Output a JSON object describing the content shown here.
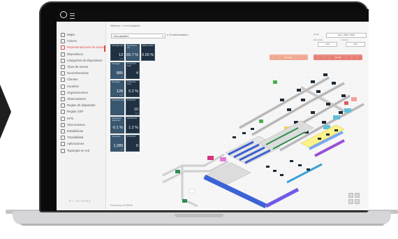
{
  "breadcrumb": "Waterrup  >  Línea playables",
  "sidebar": {
    "items": [
      {
        "label": "Mapa",
        "active": false
      },
      {
        "label": "Activos",
        "active": false
      },
      {
        "label": "Representaciones de activos",
        "active": true
      },
      {
        "label": "Dispositivos",
        "active": false
      },
      {
        "label": "Categorías de dispositivos",
        "active": false
      },
      {
        "label": "Tipos de sensor",
        "active": false
      },
      {
        "label": "Georreferencias",
        "active": false
      },
      {
        "label": "Clientes",
        "active": false
      },
      {
        "label": "Usuarios",
        "active": false
      },
      {
        "label": "Organizaciones",
        "active": false
      },
      {
        "label": "Observadores",
        "active": false
      },
      {
        "label": "Reglas de disparador",
        "active": false
      },
      {
        "label": "Reglas CEP",
        "active": false
      },
      {
        "label": "KPIs",
        "active": false
      },
      {
        "label": "Sincronismos",
        "active": false
      },
      {
        "label": "Estadísticas",
        "active": false
      },
      {
        "label": "Trazabilidad",
        "active": false
      },
      {
        "label": "Aplicaciones",
        "active": false
      },
      {
        "label": "Topología en red",
        "active": false
      }
    ],
    "brand": "BY IOTSENS"
  },
  "filter": {
    "value": "Línea playables",
    "selected_label": "10 seleccionados"
  },
  "date_panel": {
    "label_from": "Desde",
    "date_value": "Apr 1, 2020 - Tarde",
    "label_start": "Hora inicio",
    "label_end": "Hora fin",
    "start_value": "1:00",
    "end_value": "1:52"
  },
  "actions": {
    "left_button": "Exportar",
    "right_button": "Cerrar"
  },
  "metric_cards": [
    {
      "title": "Total agua (l/h)",
      "value": "13",
      "unit": "m³/h"
    },
    {
      "title": "Rendimiento (%)",
      "value": "65.7 %",
      "unit": ""
    },
    {
      "title": "Ratio de fallos",
      "value": "0.00 %",
      "unit": ""
    },
    {
      "title": "Total agua",
      "value": "885",
      "unit": "m³"
    },
    {
      "title": "Producción bruta",
      "value": "4",
      "unit": ""
    },
    {
      "title": "Total agua",
      "value": "128",
      "unit": "m³/h"
    },
    {
      "title": "Producción bruta",
      "value": "0.2 %",
      "unit": ""
    },
    {
      "title": "Producción total",
      "value": "",
      "unit": ""
    },
    {
      "title": "Producción",
      "value": "10",
      "unit": "m³/h"
    },
    {
      "title": "Rendimiento producción",
      "value": "-0.1 %",
      "unit": ""
    },
    {
      "title": "Rendimiento",
      "value": "1.2 %",
      "unit": ""
    },
    {
      "title": "Producción",
      "value": "1,289",
      "unit": "m³"
    },
    {
      "title": "Producción",
      "value": "0",
      "unit": ""
    }
  ],
  "footer": "Powered by  IOTSENS",
  "colors": {
    "accent": "#e04a4a",
    "card": "#1f3142",
    "action_left": "#f0a890",
    "action_right": "#e87f74"
  }
}
